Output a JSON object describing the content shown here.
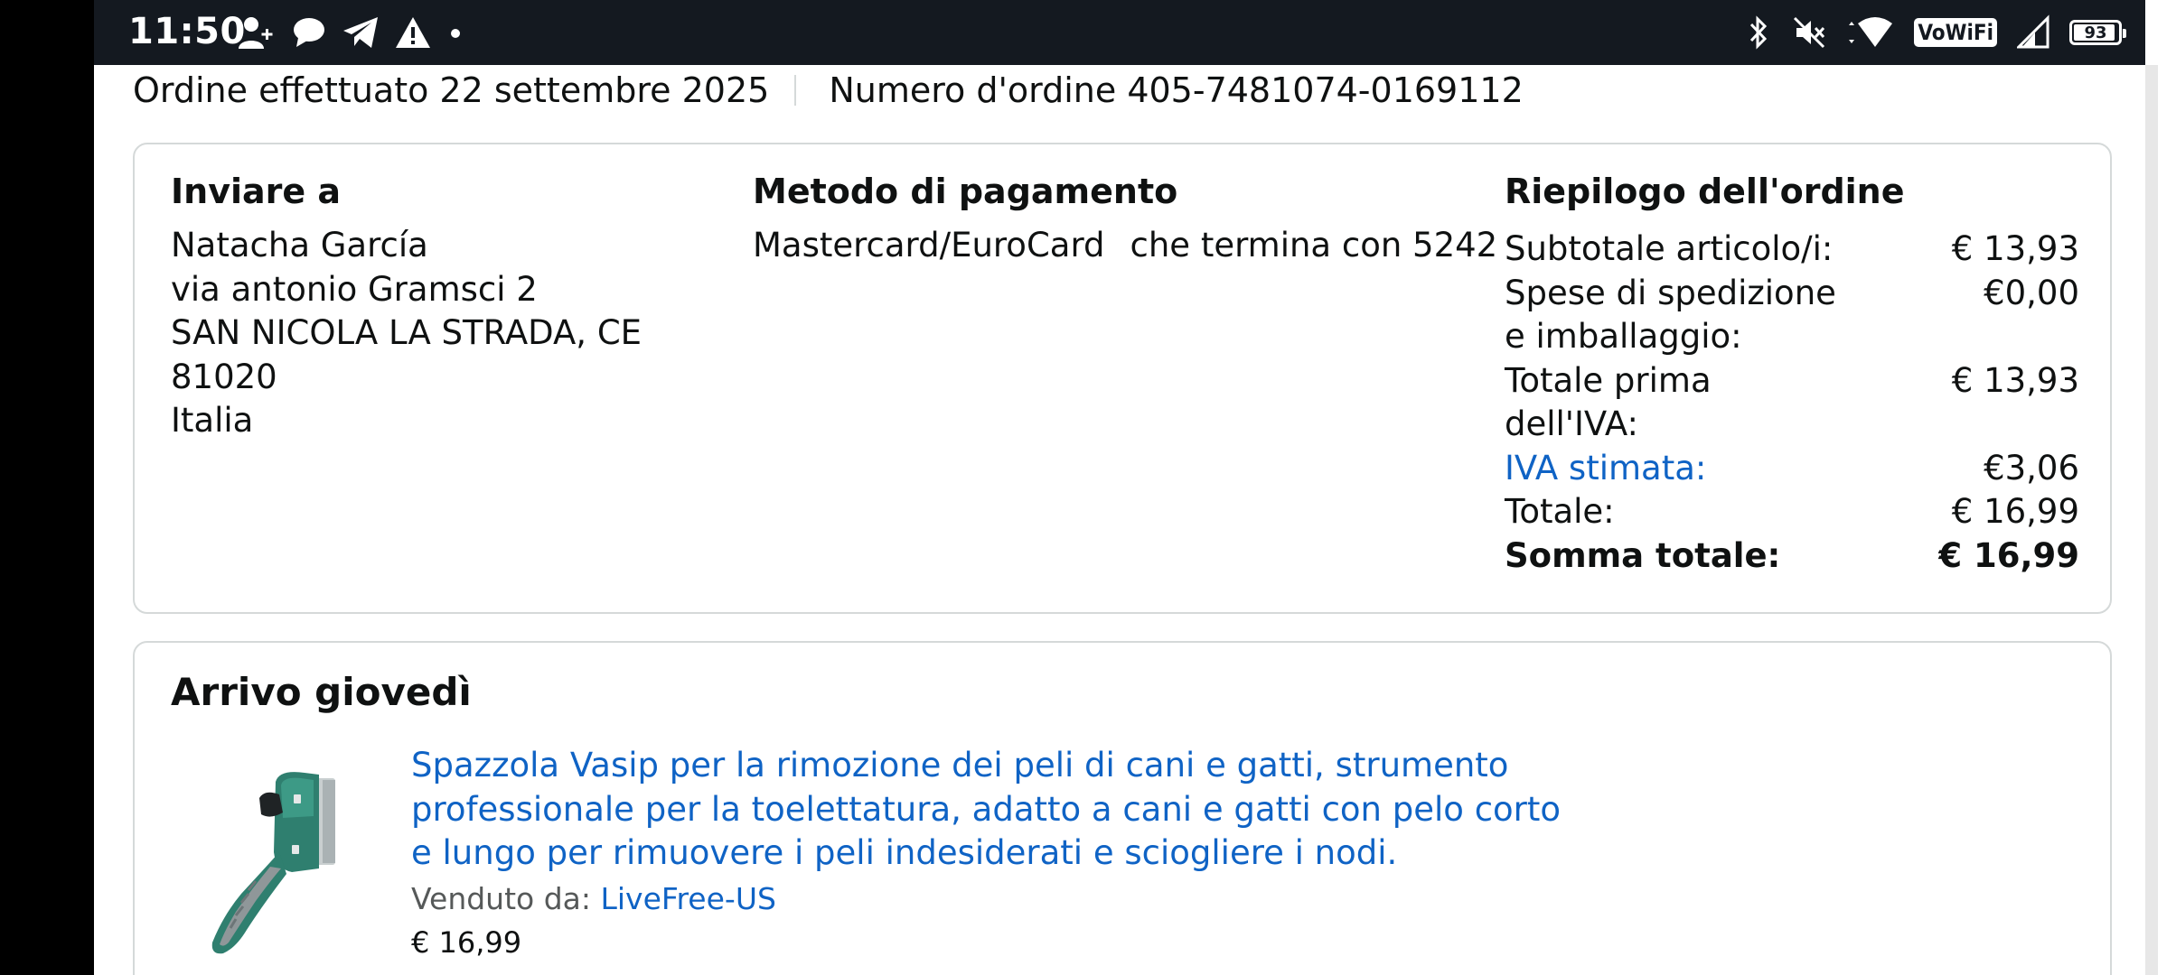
{
  "status_bar": {
    "time": "11:50",
    "battery": "93",
    "wifi_calling": "VoWiFi",
    "left_icons": [
      "person-add-icon",
      "chat-bubble-icon",
      "telegram-icon",
      "warning-icon",
      "dot-icon"
    ],
    "right_icons": [
      "bluetooth-icon",
      "mute-icon",
      "wifi-icon",
      "vowifi-icon",
      "signal-icon",
      "battery-icon"
    ]
  },
  "order": {
    "placed": "Ordine effettuato 22 settembre 2025",
    "number": "Numero d'ordine 405-7481074-0169112"
  },
  "shipping": {
    "title": "Inviare a",
    "lines": [
      "Natacha García",
      "via antonio Gramsci 2",
      "SAN NICOLA LA STRADA, CE",
      "81020",
      "Italia"
    ]
  },
  "payment": {
    "title": "Metodo di pagamento",
    "card": "Mastercard/EuroCard",
    "ending": "che termina con 5242"
  },
  "summary": {
    "title": "Riepilogo dell'ordine",
    "rows": [
      {
        "label": "Subtotale articolo/i:",
        "value": "€ 13,93"
      },
      {
        "label": "Spese di spedizione e imballaggio:",
        "value": "€0,00"
      },
      {
        "label": "Totale prima dell'IVA:",
        "value": "€ 13,93"
      },
      {
        "label": "IVA stimata:",
        "value": "€3,06"
      },
      {
        "label": "Totale:",
        "value": "€ 16,99"
      },
      {
        "label": "Somma totale:",
        "value": "€ 16,99"
      }
    ]
  },
  "shipment": {
    "arrival": "Arrivo giovedì",
    "product": {
      "title": "Spazzola Vasip per la rimozione dei peli di cani e gatti, strumento professionale per la toelettatura, adatto a cani e gatti con pelo corto e lungo per rimuovere i peli indesiderati e sciogliere i nodi.",
      "sold_by_label": "Venduto da:",
      "seller": "LiveFree-US",
      "price": "€ 16,99",
      "image_icon": "pet-grooming-brush-image"
    }
  },
  "colors": {
    "link": "#0f63c5",
    "status_bar": "#141920",
    "border": "#d5d9d9"
  }
}
